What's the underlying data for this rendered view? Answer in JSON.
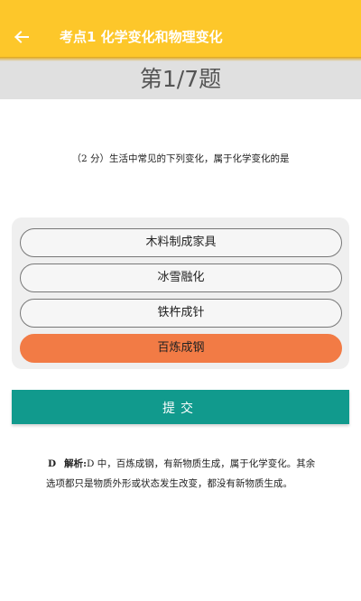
{
  "header": {
    "back_icon": "arrow-left-icon",
    "title": "考点1 化学变化和物理变化",
    "background_color": "#fdc72a"
  },
  "progress": {
    "counter_label": "第1/7题",
    "current": 1,
    "total": 7
  },
  "question": {
    "text": "（2 分）生活中常见的下列变化，属于化学变化的是"
  },
  "options": [
    {
      "label": "木料制成家具",
      "selected": false
    },
    {
      "label": "冰雪融化",
      "selected": false
    },
    {
      "label": "铁杵成针",
      "selected": false
    },
    {
      "label": "百炼成钢",
      "selected": true
    }
  ],
  "selected_color": "#f27b45",
  "submit": {
    "label": "提交",
    "color": "#119a8d"
  },
  "explanation": {
    "answer": "D",
    "label": "解析:",
    "text": "D 中，百炼成钢，有新物质生成，属于化学变化。其余选项都只是物质外形或状态发生改变，都没有新物质生成。"
  }
}
